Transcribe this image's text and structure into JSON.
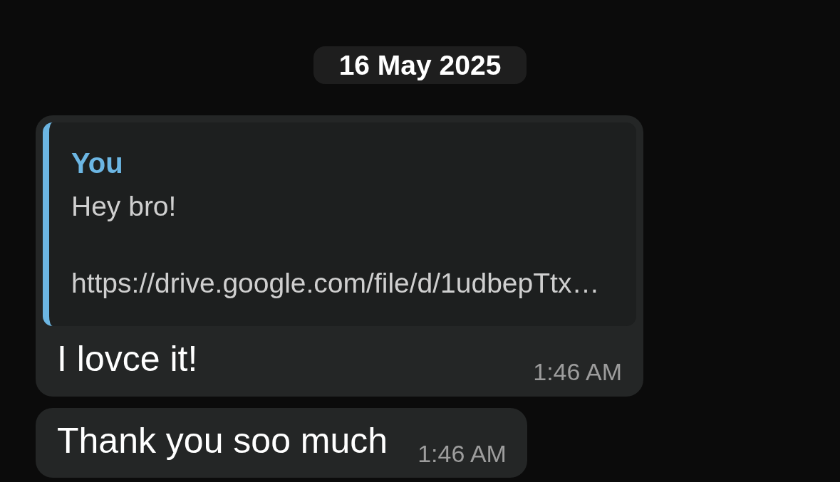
{
  "date_separator": "16 May 2025",
  "messages": [
    {
      "reply_to": {
        "sender": "You",
        "text": "Hey bro!\n\nhttps://drive.google.com/file/d/1udbepTtx…"
      },
      "text": "I lovce it!",
      "time": "1:46 AM"
    },
    {
      "text": "Thank you soo much",
      "time": "1:46 AM"
    }
  ]
}
